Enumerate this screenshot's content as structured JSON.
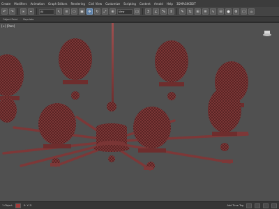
{
  "menubar": {
    "items": [
      "Create",
      "Modifiers",
      "Animation",
      "Graph Editors",
      "Rendering",
      "Civil View",
      "Customize",
      "Scripting",
      "Content",
      "Arnold",
      "Help",
      "3DMAGIKEDIT"
    ]
  },
  "toolbar": {
    "selection_filter": "All",
    "view_dropdown": "View"
  },
  "ribbon": {
    "items": [
      "Object Paint",
      "Populate"
    ]
  },
  "viewport": {
    "label": "[+] [Pers]"
  },
  "status": {
    "selected": "1 Object",
    "coords": "X:  Y:  Z:",
    "add_time_tag": "Add Time Tag"
  },
  "colors": {
    "model": "#8a3f3f",
    "viewport_bg": "#505050",
    "active_tool": "#5d7fa6"
  }
}
